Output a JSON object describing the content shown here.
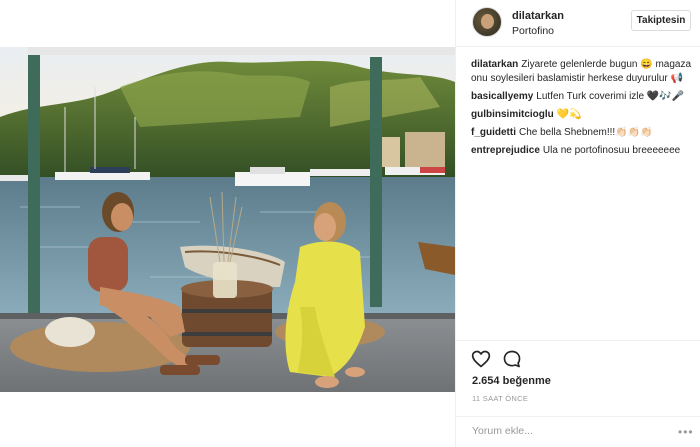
{
  "post": {
    "author": {
      "username": "dilatarkan",
      "location": "Portofino",
      "follow_label": "Takiptesin"
    },
    "comments": [
      {
        "user": "dilatarkan",
        "text": "Ziyarete gelenlerde bugun 😄 magaza onu soylesileri baslamistir herkese duyurulur 📢"
      },
      {
        "user": "basicallyemy",
        "text": "Lutfen Turk coverimi izle 🖤🎶🎤"
      },
      {
        "user": "gulbinsimitcioglu",
        "text": "💛💫"
      },
      {
        "user": "f_guidetti",
        "text": "Che bella Shebnem!!!👏🏻👏🏻👏🏻"
      },
      {
        "user": "entreprejudice",
        "text": "Ula ne portofinosuu breeeeeee"
      }
    ],
    "likes": {
      "count": "2.654",
      "label": "beğenme"
    },
    "time_ago": "11 SAAT ÖNCE",
    "add_comment_placeholder": "Yorum ekle...",
    "more_options": "•••"
  },
  "icons": {
    "like": "heart-outline",
    "comment": "speech-bubble-outline"
  }
}
